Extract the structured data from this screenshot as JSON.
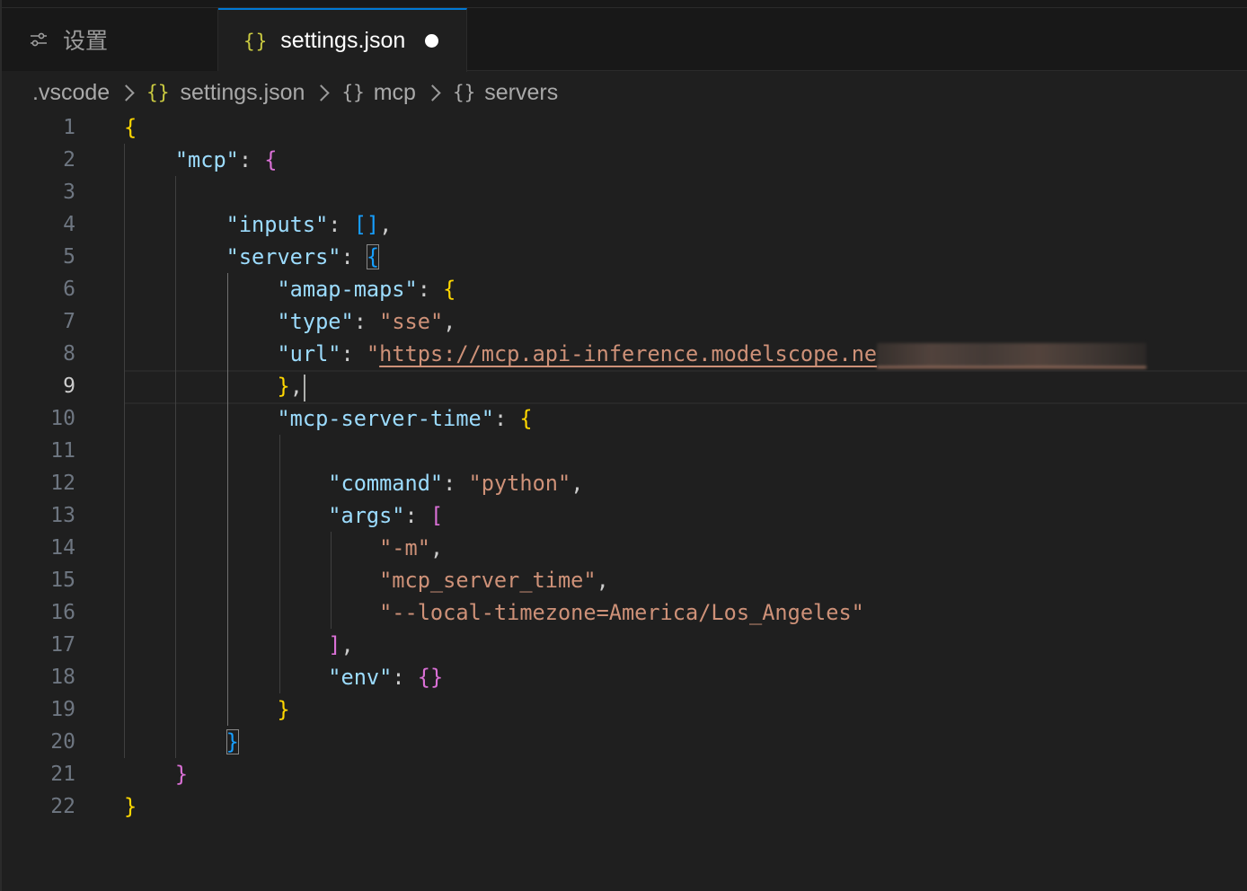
{
  "tabs": [
    {
      "label": "设置",
      "icon": "sliders-icon",
      "active": false
    },
    {
      "label": "settings.json",
      "icon": "json-braces-icon",
      "active": true,
      "dirty": true
    }
  ],
  "breadcrumb": [
    {
      "label": ".vscode",
      "icon": ""
    },
    {
      "label": "settings.json",
      "icon": "json-braces-icon"
    },
    {
      "label": "mcp",
      "icon": "object-braces-icon"
    },
    {
      "label": "servers",
      "icon": "object-braces-icon"
    }
  ],
  "editor": {
    "active_line": 9,
    "line_numbers": [
      "1",
      "2",
      "3",
      "4",
      "5",
      "6",
      "7",
      "8",
      "9",
      "10",
      "11",
      "12",
      "13",
      "14",
      "15",
      "16",
      "17",
      "18",
      "19",
      "20",
      "21",
      "22"
    ],
    "url_visible": "https://mcp.api-inference.modelscope.ne",
    "lines": {
      "l4_key": "\"inputs\"",
      "l5_key": "\"servers\"",
      "l6_key": "\"amap-maps\"",
      "l7_key": "\"type\"",
      "l7_val": "\"sse\"",
      "l8_key": "\"url\"",
      "l10_key": "\"mcp-server-time\"",
      "l12_key": "\"command\"",
      "l12_val": "\"python\"",
      "l13_key": "\"args\"",
      "l14_val": "\"-m\"",
      "l15_val": "\"mcp_server_time\"",
      "l16_val": "\"--local-timezone=America/Los_Angeles\"",
      "l18_key": "\"env\"",
      "l2_key": "\"mcp\""
    }
  },
  "colors": {
    "background": "#1f1f1f",
    "key": "#9cdcfe",
    "string": "#ce9178",
    "bracket_gold": "#ffd700",
    "bracket_orchid": "#da70d6",
    "bracket_blue": "#179fff",
    "tab_accent": "#0078d4"
  }
}
